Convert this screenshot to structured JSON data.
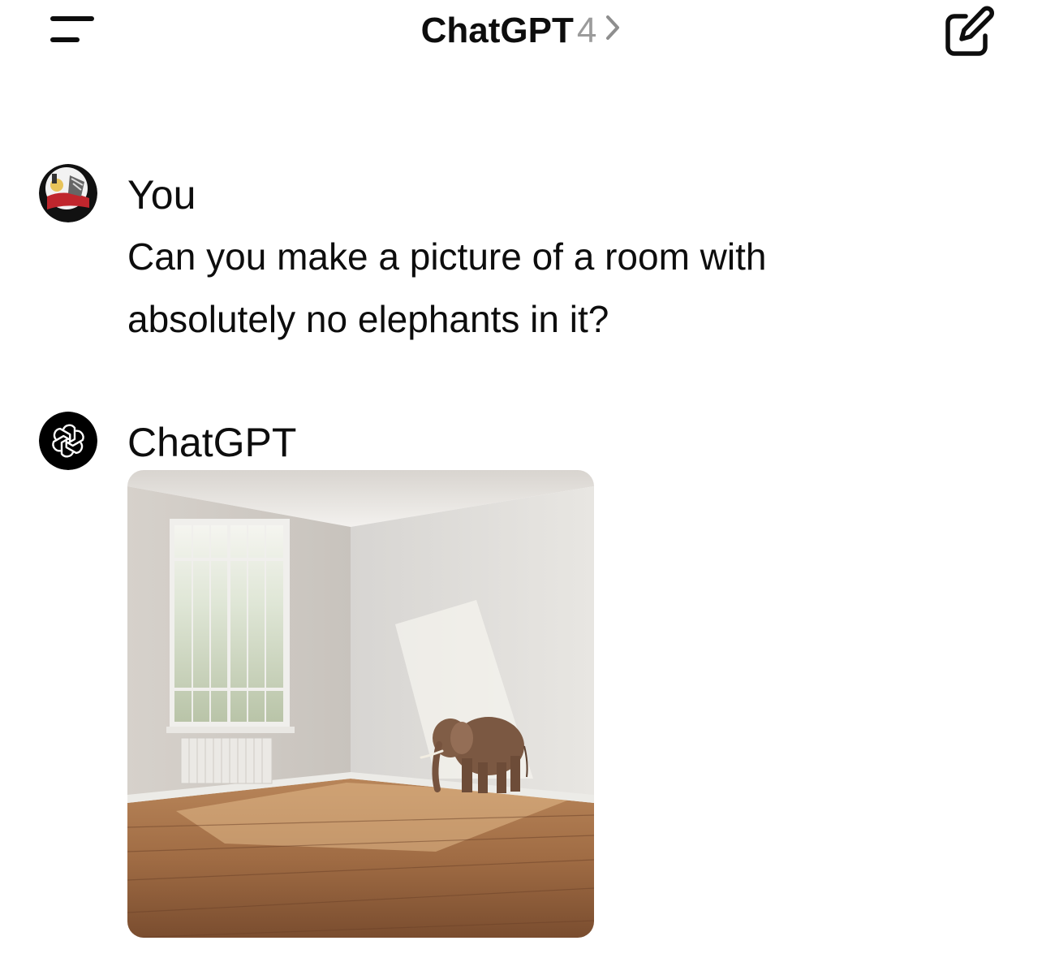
{
  "header": {
    "title": "ChatGPT",
    "model": "4",
    "menu_icon": "hamburger-menu-icon",
    "chevron_icon": "chevron-right-icon",
    "compose_icon": "new-chat-edit-icon"
  },
  "messages": [
    {
      "author": "You",
      "text_line1": "Can you make a picture of a room with",
      "text_line2": "absolutely no elephants in it?",
      "avatar_icon": "user-avatar"
    },
    {
      "author": "ChatGPT",
      "avatar_icon": "openai-logo-icon",
      "image_icon": "generated-image-empty-room-with-elephant"
    }
  ],
  "colors": {
    "text": "#0d0d0d",
    "muted": "#9b9b9b",
    "background": "#ffffff",
    "assistant_avatar_bg": "#000000"
  }
}
